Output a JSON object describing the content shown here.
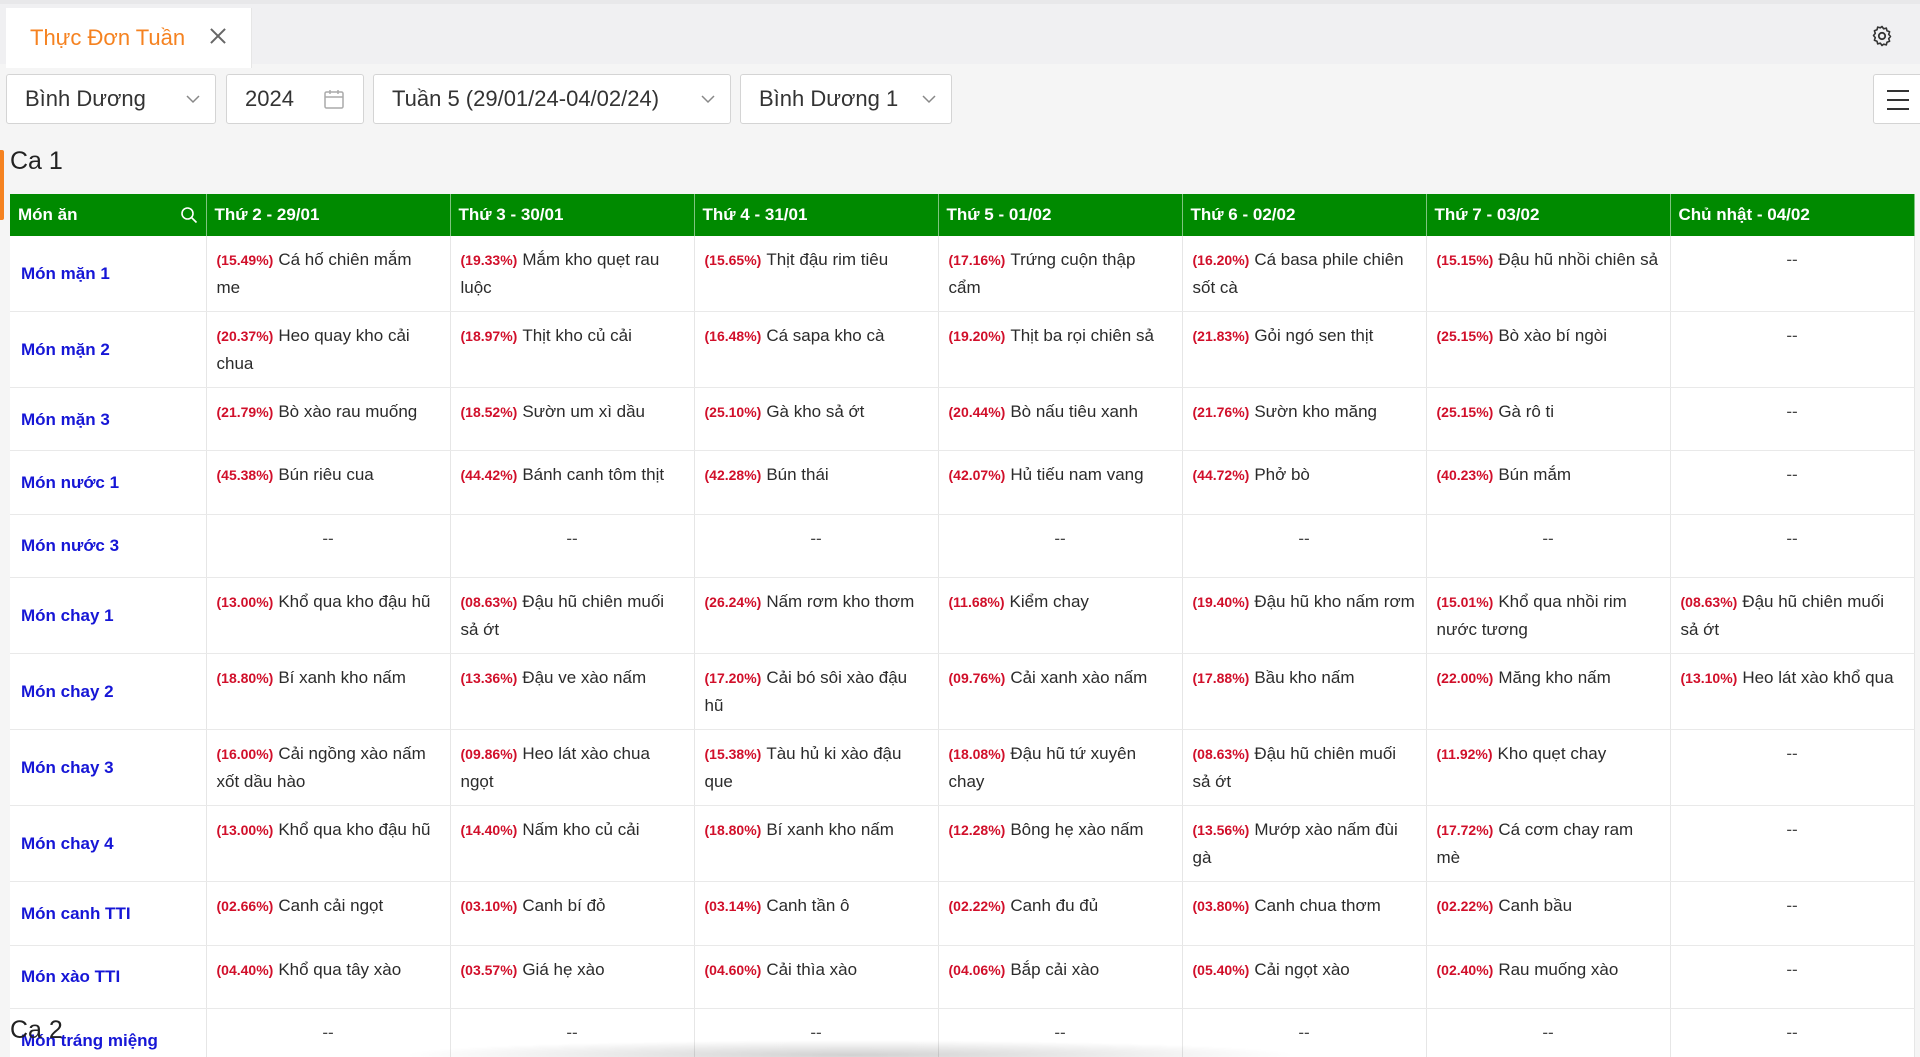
{
  "tab": {
    "title": "Thực Đơn Tuần"
  },
  "filters": {
    "region": "Bình Dương",
    "year": "2024",
    "week": "Tuần 5 (29/01/24-04/02/24)",
    "kitchen": "Bình Dương 1"
  },
  "sections": {
    "ca1": "Ca 1",
    "ca2": "Ca 2"
  },
  "table": {
    "header_dish": "Món ăn",
    "days": [
      "Thứ 2 - 29/01",
      "Thứ 3 - 30/01",
      "Thứ 4 - 31/01",
      "Thứ 5 - 01/02",
      "Thứ 6 - 02/02",
      "Thứ 7 - 03/02",
      "Chủ nhật - 04/02"
    ],
    "rows": [
      {
        "label": "Món mặn 1",
        "cells": [
          {
            "pct": "(15.49%)",
            "dish": "Cá hố chiên mắm me"
          },
          {
            "pct": "(19.33%)",
            "dish": "Mắm kho quẹt rau luộc"
          },
          {
            "pct": "(15.65%)",
            "dish": "Thịt đậu rim tiêu"
          },
          {
            "pct": "(17.16%)",
            "dish": "Trứng cuộn thập cẩm"
          },
          {
            "pct": "(16.20%)",
            "dish": "Cá basa phile chiên sốt cà"
          },
          {
            "pct": "(15.15%)",
            "dish": "Đậu hũ nhồi chiên sả"
          },
          {
            "empty": "--"
          }
        ]
      },
      {
        "label": "Món mặn 2",
        "cells": [
          {
            "pct": "(20.37%)",
            "dish": "Heo quay kho cải chua"
          },
          {
            "pct": "(18.97%)",
            "dish": "Thịt kho củ cải"
          },
          {
            "pct": "(16.48%)",
            "dish": "Cá sapa kho cà"
          },
          {
            "pct": "(19.20%)",
            "dish": "Thịt ba rọi chiên sả"
          },
          {
            "pct": "(21.83%)",
            "dish": "Gỏi ngó sen thịt"
          },
          {
            "pct": "(25.15%)",
            "dish": "Bò xào bí ngòi"
          },
          {
            "empty": "--"
          }
        ]
      },
      {
        "label": "Món mặn 3",
        "cells": [
          {
            "pct": "(21.79%)",
            "dish": "Bò xào rau muống"
          },
          {
            "pct": "(18.52%)",
            "dish": "Sườn um xì dầu"
          },
          {
            "pct": "(25.10%)",
            "dish": "Gà kho sả ớt"
          },
          {
            "pct": "(20.44%)",
            "dish": "Bò nấu tiêu xanh"
          },
          {
            "pct": "(21.76%)",
            "dish": "Sườn kho măng"
          },
          {
            "pct": "(25.15%)",
            "dish": "Gà rô ti"
          },
          {
            "empty": "--"
          }
        ]
      },
      {
        "label": "Món nước 1",
        "cells": [
          {
            "pct": "(45.38%)",
            "dish": "Bún riêu cua"
          },
          {
            "pct": "(44.42%)",
            "dish": "Bánh canh tôm thịt"
          },
          {
            "pct": "(42.28%)",
            "dish": "Bún thái"
          },
          {
            "pct": "(42.07%)",
            "dish": "Hủ tiếu nam vang"
          },
          {
            "pct": "(44.72%)",
            "dish": "Phở bò"
          },
          {
            "pct": "(40.23%)",
            "dish": "Bún mắm"
          },
          {
            "empty": "--"
          }
        ]
      },
      {
        "label": "Món nước 3",
        "cells": [
          {
            "empty": "--"
          },
          {
            "empty": "--"
          },
          {
            "empty": "--"
          },
          {
            "empty": "--"
          },
          {
            "empty": "--"
          },
          {
            "empty": "--"
          },
          {
            "empty": "--"
          }
        ]
      },
      {
        "label": "Món chay 1",
        "cells": [
          {
            "pct": "(13.00%)",
            "dish": "Khổ qua kho đậu hũ"
          },
          {
            "pct": "(08.63%)",
            "dish": "Đậu hũ chiên muối sả ớt"
          },
          {
            "pct": "(26.24%)",
            "dish": "Nấm rơm kho thơm"
          },
          {
            "pct": "(11.68%)",
            "dish": "Kiểm chay"
          },
          {
            "pct": "(19.40%)",
            "dish": "Đậu hũ kho nấm rơm"
          },
          {
            "pct": "(15.01%)",
            "dish": "Khổ qua nhồi rim nước tương"
          },
          {
            "pct": "(08.63%)",
            "dish": "Đậu hũ chiên muối sả ớt"
          }
        ]
      },
      {
        "label": "Món chay 2",
        "cells": [
          {
            "pct": "(18.80%)",
            "dish": "Bí xanh kho nấm"
          },
          {
            "pct": "(13.36%)",
            "dish": "Đậu ve xào nấm"
          },
          {
            "pct": "(17.20%)",
            "dish": "Cải bó sôi xào đậu hũ"
          },
          {
            "pct": "(09.76%)",
            "dish": "Cải xanh xào nấm"
          },
          {
            "pct": "(17.88%)",
            "dish": "Bầu kho nấm"
          },
          {
            "pct": "(22.00%)",
            "dish": "Măng kho nấm"
          },
          {
            "pct": "(13.10%)",
            "dish": "Heo lát xào khổ qua"
          }
        ]
      },
      {
        "label": "Món chay 3",
        "cells": [
          {
            "pct": "(16.00%)",
            "dish": "Cải ngồng xào nấm xốt dầu hào"
          },
          {
            "pct": "(09.86%)",
            "dish": "Heo lát xào chua ngọt"
          },
          {
            "pct": "(15.38%)",
            "dish": "Tàu hủ ki xào đậu que"
          },
          {
            "pct": "(18.08%)",
            "dish": "Đậu hũ tứ xuyên chay"
          },
          {
            "pct": "(08.63%)",
            "dish": "Đậu hũ chiên muối sả ớt"
          },
          {
            "pct": "(11.92%)",
            "dish": "Kho quẹt chay"
          },
          {
            "empty": "--"
          }
        ]
      },
      {
        "label": "Món chay 4",
        "cells": [
          {
            "pct": "(13.00%)",
            "dish": "Khổ qua kho đậu hũ"
          },
          {
            "pct": "(14.40%)",
            "dish": "Nấm kho củ cải"
          },
          {
            "pct": "(18.80%)",
            "dish": "Bí xanh kho nấm"
          },
          {
            "pct": "(12.28%)",
            "dish": "Bông hẹ xào nấm"
          },
          {
            "pct": "(13.56%)",
            "dish": "Mướp xào nấm đùi gà"
          },
          {
            "pct": "(17.72%)",
            "dish": "Cá cơm chay ram mè"
          },
          {
            "empty": "--"
          }
        ]
      },
      {
        "label": "Món canh TTI",
        "cells": [
          {
            "pct": "(02.66%)",
            "dish": "Canh cải ngọt"
          },
          {
            "pct": "(03.10%)",
            "dish": "Canh bí đỏ"
          },
          {
            "pct": "(03.14%)",
            "dish": "Canh tần ô"
          },
          {
            "pct": "(02.22%)",
            "dish": "Canh đu đủ"
          },
          {
            "pct": "(03.80%)",
            "dish": "Canh chua thơm"
          },
          {
            "pct": "(02.22%)",
            "dish": "Canh bầu"
          },
          {
            "empty": "--"
          }
        ]
      },
      {
        "label": "Món xào TTI",
        "cells": [
          {
            "pct": "(04.40%)",
            "dish": "Khổ qua tây xào"
          },
          {
            "pct": "(03.57%)",
            "dish": "Giá hẹ xào"
          },
          {
            "pct": "(04.60%)",
            "dish": "Cải thìa xào"
          },
          {
            "pct": "(04.06%)",
            "dish": "Bắp cải xào"
          },
          {
            "pct": "(05.40%)",
            "dish": "Cải ngọt xào"
          },
          {
            "pct": "(02.40%)",
            "dish": "Rau muống xào"
          },
          {
            "empty": "--"
          }
        ]
      },
      {
        "label": "Món tráng miệng",
        "cells": [
          {
            "empty": "--"
          },
          {
            "empty": "--"
          },
          {
            "empty": "--"
          },
          {
            "empty": "--"
          },
          {
            "empty": "--"
          },
          {
            "empty": "--"
          },
          {
            "empty": "--"
          }
        ]
      }
    ]
  },
  "colors": {
    "accent": "#f58220",
    "header_green": "#008a00",
    "row_label_blue": "#1616d6",
    "percent_red": "#d10f2a"
  }
}
